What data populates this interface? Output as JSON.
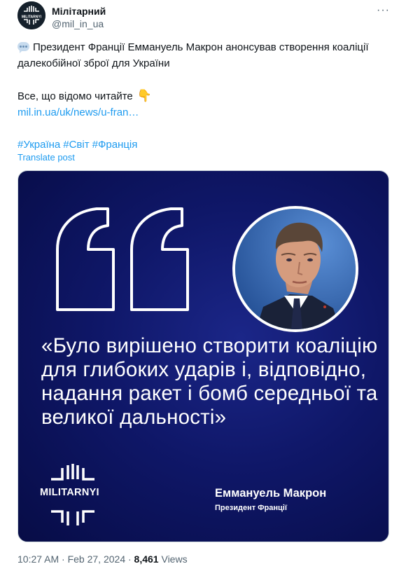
{
  "account": {
    "name": "Мілітарний",
    "handle": "@mil_in_ua",
    "more_label": "···",
    "avatar_icon": "militarnyi-logo-icon"
  },
  "post": {
    "line1": "Президент Франції Еммануель Макрон анонсував створення коаліції далекобійної зброї для України",
    "line2": "Все, що відомо читайте",
    "link": "mil.in.ua/uk/news/u-fran…",
    "hashtags": [
      "#Україна",
      "#Світ",
      "#Франція"
    ],
    "translate": "Translate post"
  },
  "card": {
    "quote": "«Було вирішено створити коаліцію для глибоких ударів і, відповідно, надання ракет і бомб середньої та великої дальності»",
    "logo_text": "MILITARNYI",
    "author": "Еммануель Макрон",
    "author_title": "Президент Франції",
    "bg_color": "#0f1768"
  },
  "footer": {
    "time_date": "10:27 AM · Feb 27, 2024 ·",
    "views_count": "8,461",
    "views_label": "Views"
  }
}
